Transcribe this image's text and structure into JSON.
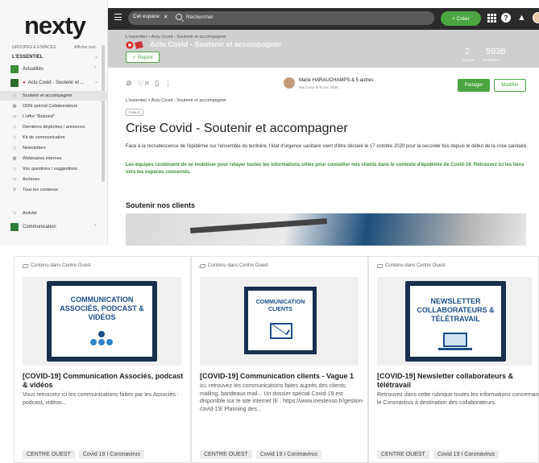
{
  "sidebar": {
    "logo": "nexty",
    "groups_label": "GROUPES & ESPACES",
    "show_all": "Afficher tout",
    "section": "L'ESSENTIEL",
    "spaces": [
      {
        "label": "Actualités",
        "color": "#3b8f3a"
      },
      {
        "label": "Actu Covid - Soutenir et ...",
        "color": "#2d6b2d"
      }
    ],
    "subitems": [
      {
        "label": "Soutenir et accompagner",
        "icon": "gem-icon",
        "active": true
      },
      {
        "label": "ODN spécial Collaborateurs",
        "icon": "grid-icon"
      },
      {
        "label": "L'offre \"Rebond\"",
        "icon": "doc-icon"
      },
      {
        "label": "Dernières dépêches / annonces",
        "icon": "gem-icon"
      },
      {
        "label": "Kit de communication",
        "icon": "gem-icon"
      },
      {
        "label": "Newsletters",
        "icon": "gem-icon"
      },
      {
        "label": "Webinaires internes",
        "icon": "grid-icon"
      },
      {
        "label": "Vos questions / suggestions",
        "icon": "gem-icon"
      },
      {
        "label": "Archives",
        "icon": "doc-icon"
      },
      {
        "label": "Tous les contenus",
        "icon": "search-icon"
      }
    ],
    "activity": "Activité",
    "communication": "Communication"
  },
  "topbar": {
    "scope": "Cet espace",
    "search_placeholder": "Rechercher",
    "create": "+ Créer"
  },
  "banner": {
    "crumb": "L'essentiel > Actu Covid - Soutenir et accompagner",
    "title": "Actu Covid - Soutenir et accompagner",
    "join": "✓ Rejoint",
    "admins_value": "2",
    "admins_label": "ADMINS",
    "members_value": "5936",
    "members_label": "MEMBRES"
  },
  "article": {
    "likes": "26",
    "author": "Marie HARAUCHAMPS & 5 autres",
    "date": "Mis à jour le 9 nov. 2020",
    "share": "Partager",
    "edit": "Modifier",
    "crumb": "L'essentiel > Actu Covid - Soutenir et accompagner",
    "badge": "PUBLIC",
    "title": "Crise Covid - Soutenir et accompagner",
    "intro": "Face à la recrudescence de l'épidémie sur l'ensemble du territoire, l'état d'urgence sanitaire vient d'être déclaré le 17 octobre 2020 pour la seconde fois depuis le début de la crise sanitaire.",
    "highlight": "Les équipes continuent de se mobiliser pour relayer toutes les informations utiles pour conseiller nos clients dans le contexte d'épidémie de Covid-19. Retrouvez ici les liens vers les espaces concernés.",
    "section": "Soutenir nos clients"
  },
  "cards": [
    {
      "source": "Contenu dans Centre Ouest",
      "thumb_text": "COMMUNICATION ASSOCIÉS, PODCAST & VIDÉOS",
      "title": "[COVID-19] Communication Associés, podcast & vidéos",
      "desc": "Vous retrouvez ici les communications faites par les Associés : podcast, vidéos...",
      "tags": [
        "CENTRE OUEST",
        "Covid 19 I Coronavirus"
      ]
    },
    {
      "source": "Contenu dans Centre Ouest",
      "thumb_text": "COMMUNICATION CLIENTS",
      "title": "[COVID-19] Communication clients - Vague 1",
      "desc": "Ici, retrouvez les communications faites auprès des clients: mailing, bandeaux mail... Un dossier spécial Covid-19 est disponible sur le site internet IE : https://www.inextenso.fr/gestion-covid-19/ Planning des...",
      "tags": [
        "CENTRE OUEST",
        "Covid 19 I Coronavirus"
      ]
    },
    {
      "source": "Contenu dans Centre Ouest",
      "thumb_text": "NEWSLETTER COLLABORATEURS & TÉLÉTRAVAIL",
      "title": "[COVID-19] Newsletter collaborateurs & télétravail",
      "desc": "Retrouvez dans cette rubrique toutes les informations concernant le Coronavirus à destination des collaborateurs.",
      "tags": [
        "CENTRE OUEST",
        "Covid 19 I Coronavirus"
      ]
    }
  ],
  "colors": {
    "accent": "#4ca542",
    "thumb_blue": "#1b4e87",
    "thumb_frame": "#1a2f4d"
  }
}
